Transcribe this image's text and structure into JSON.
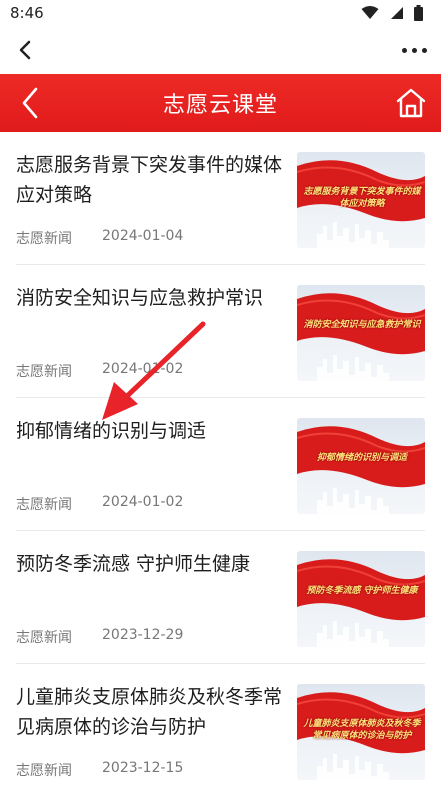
{
  "status": {
    "time": "8:46"
  },
  "header": {
    "title": "志愿云课堂"
  },
  "articles": [
    {
      "title": "志愿服务背景下突发事件的媒体应对策略",
      "source": "志愿新闻",
      "date": "2024-01-04",
      "thumb_text": "志愿服务背景下突发事件的媒体应对策略"
    },
    {
      "title": "消防安全知识与应急救护常识",
      "source": "志愿新闻",
      "date": "2024-01-02",
      "thumb_text": "消防安全知识与应急救护常识"
    },
    {
      "title": "抑郁情绪的识别与调适",
      "source": "志愿新闻",
      "date": "2024-01-02",
      "thumb_text": "抑郁情绪的识别与调适"
    },
    {
      "title": "预防冬季流感 守护师生健康",
      "source": "志愿新闻",
      "date": "2023-12-29",
      "thumb_text": "预防冬季流感 守护师生健康"
    },
    {
      "title": "儿童肺炎支原体肺炎及秋冬季常见病原体的诊治与防护",
      "source": "志愿新闻",
      "date": "2023-12-15",
      "thumb_text": "儿童肺炎支原体肺炎及秋冬季常见病原体的诊治与防护"
    }
  ],
  "colors": {
    "header_red": "#e62020",
    "annotation_arrow": "#e8232a"
  },
  "icons": [
    "wifi-icon",
    "signal-icon",
    "battery-icon",
    "back-arrow-icon",
    "more-icon",
    "header-back-icon",
    "home-icon"
  ]
}
